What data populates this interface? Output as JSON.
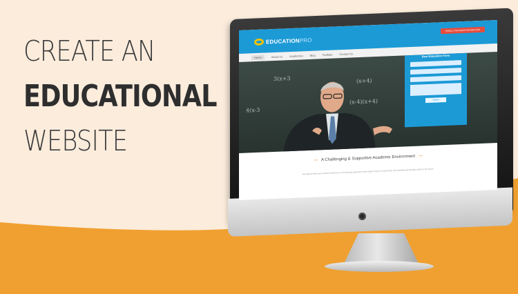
{
  "headline": {
    "line1": "CREATE AN",
    "line2": "EDUCATIONAL",
    "line3": "WEBSITE"
  },
  "colors": {
    "background": "#fbecdc",
    "wave": "#f0a030",
    "site_header": "#1c9ad6",
    "cta": "#e74c3c"
  },
  "site": {
    "logo_main": "EDUCATION",
    "logo_suffix": "PRO",
    "cta_label": "ENROLL FOR MORE INFORMATION",
    "nav": [
      "Home",
      "About Us",
      "Academics",
      "Blog",
      "Portfolio",
      "Contact Us"
    ],
    "form_title": "Best Education Form",
    "form_button": "Submit",
    "chalk_1": "3(x+3",
    "chalk_2": "(x+4)",
    "chalk_3": "4(x-3",
    "chalk_4": "(x-4)(x+4)",
    "tagline": "A Challenging & Supportive Academic Environment",
    "subtext": "We believe that every student deserves a rich learning experience that inspires them to reach their full potential and develop skills for the future."
  }
}
